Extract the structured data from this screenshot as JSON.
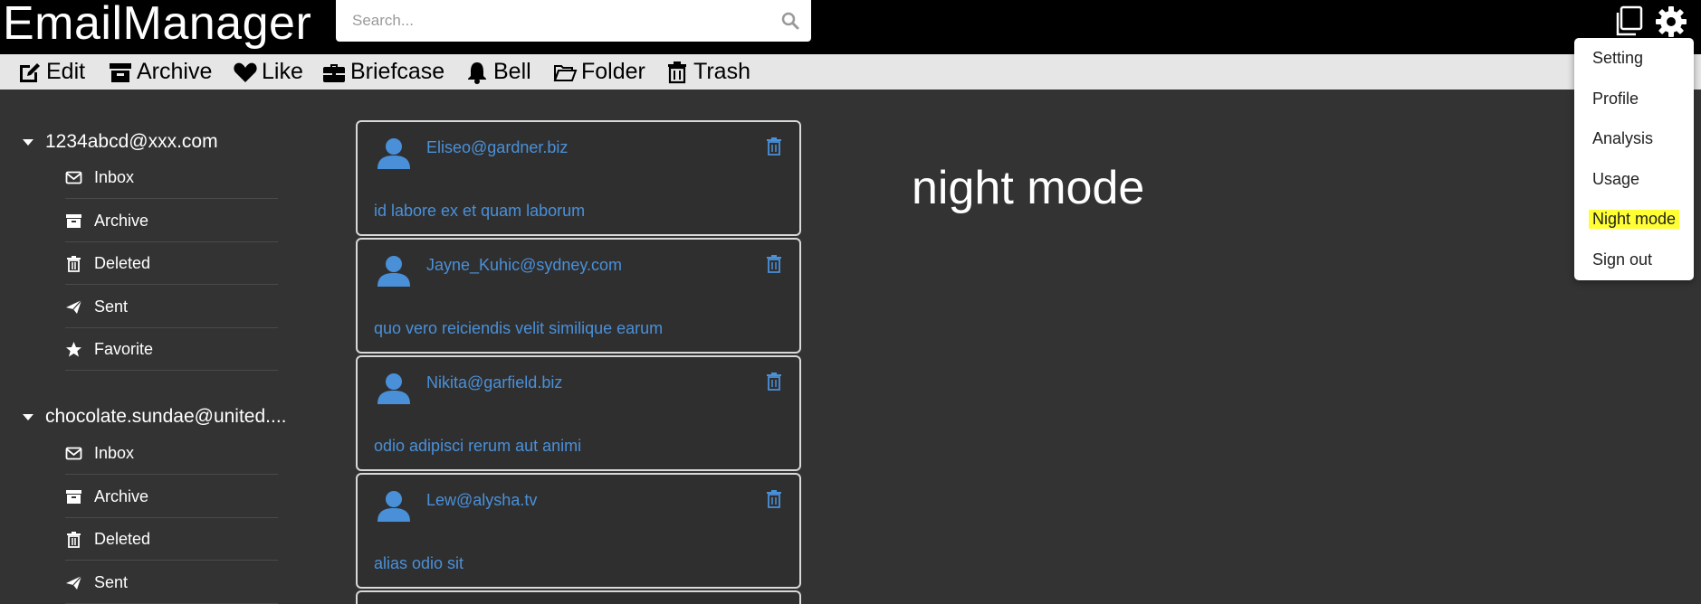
{
  "header": {
    "brand": "EmailManager",
    "search_placeholder": "Search..."
  },
  "toolbar": {
    "items": [
      {
        "label": "Edit",
        "icon": "edit-icon"
      },
      {
        "label": "Archive",
        "icon": "archive-icon"
      },
      {
        "label": "Like",
        "icon": "heart-icon"
      },
      {
        "label": "Briefcase",
        "icon": "briefcase-icon"
      },
      {
        "label": "Bell",
        "icon": "bell-icon"
      },
      {
        "label": "Folder",
        "icon": "folder-icon"
      },
      {
        "label": "Trash",
        "icon": "trash-icon"
      }
    ]
  },
  "sidebar": {
    "accounts": [
      {
        "email": "1234abcd@xxx.com",
        "folders": [
          {
            "label": "Inbox",
            "icon": "envelope-icon"
          },
          {
            "label": "Archive",
            "icon": "archive-icon"
          },
          {
            "label": "Deleted",
            "icon": "trash-icon"
          },
          {
            "label": "Sent",
            "icon": "paper-plane-icon"
          },
          {
            "label": "Favorite",
            "icon": "star-icon"
          }
        ]
      },
      {
        "email": "chocolate.sundae@united....",
        "folders": [
          {
            "label": "Inbox",
            "icon": "envelope-icon"
          },
          {
            "label": "Archive",
            "icon": "archive-icon"
          },
          {
            "label": "Deleted",
            "icon": "trash-icon"
          },
          {
            "label": "Sent",
            "icon": "paper-plane-icon"
          }
        ]
      }
    ]
  },
  "emails": [
    {
      "from": "Eliseo@gardner.biz",
      "subject": "id labore ex et quam laborum"
    },
    {
      "from": "Jayne_Kuhic@sydney.com",
      "subject": "quo vero reiciendis velit similique earum"
    },
    {
      "from": "Nikita@garfield.biz",
      "subject": "odio adipisci rerum aut animi"
    },
    {
      "from": "Lew@alysha.tv",
      "subject": "alias odio sit"
    }
  ],
  "main": {
    "title": "night mode"
  },
  "menu": {
    "items": [
      "Setting",
      "Profile",
      "Analysis",
      "Usage",
      "Night mode",
      "Sign out"
    ],
    "highlighted": "Night mode"
  },
  "colors": {
    "background": "#333333",
    "header": "#000000",
    "toolbar": "#e6e6e6",
    "accent": "#4a90d9",
    "highlight": "#ffff33"
  }
}
